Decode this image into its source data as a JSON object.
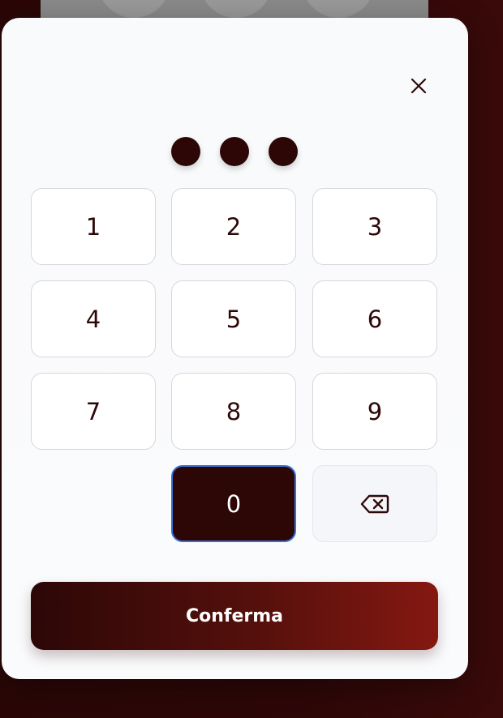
{
  "pin": {
    "filled_count": 3,
    "dot_color": "#2d0606"
  },
  "keypad": {
    "keys": [
      "1",
      "2",
      "3",
      "4",
      "5",
      "6",
      "7",
      "8",
      "9",
      "0"
    ],
    "active_key": "0",
    "backspace_icon": "backspace-icon"
  },
  "modal": {
    "close_icon": "close-icon"
  },
  "actions": {
    "confirm_label": "Conferma"
  },
  "colors": {
    "accent_dark": "#2d0606",
    "accent_red": "#851811",
    "focus_ring": "#3b6fd6"
  }
}
